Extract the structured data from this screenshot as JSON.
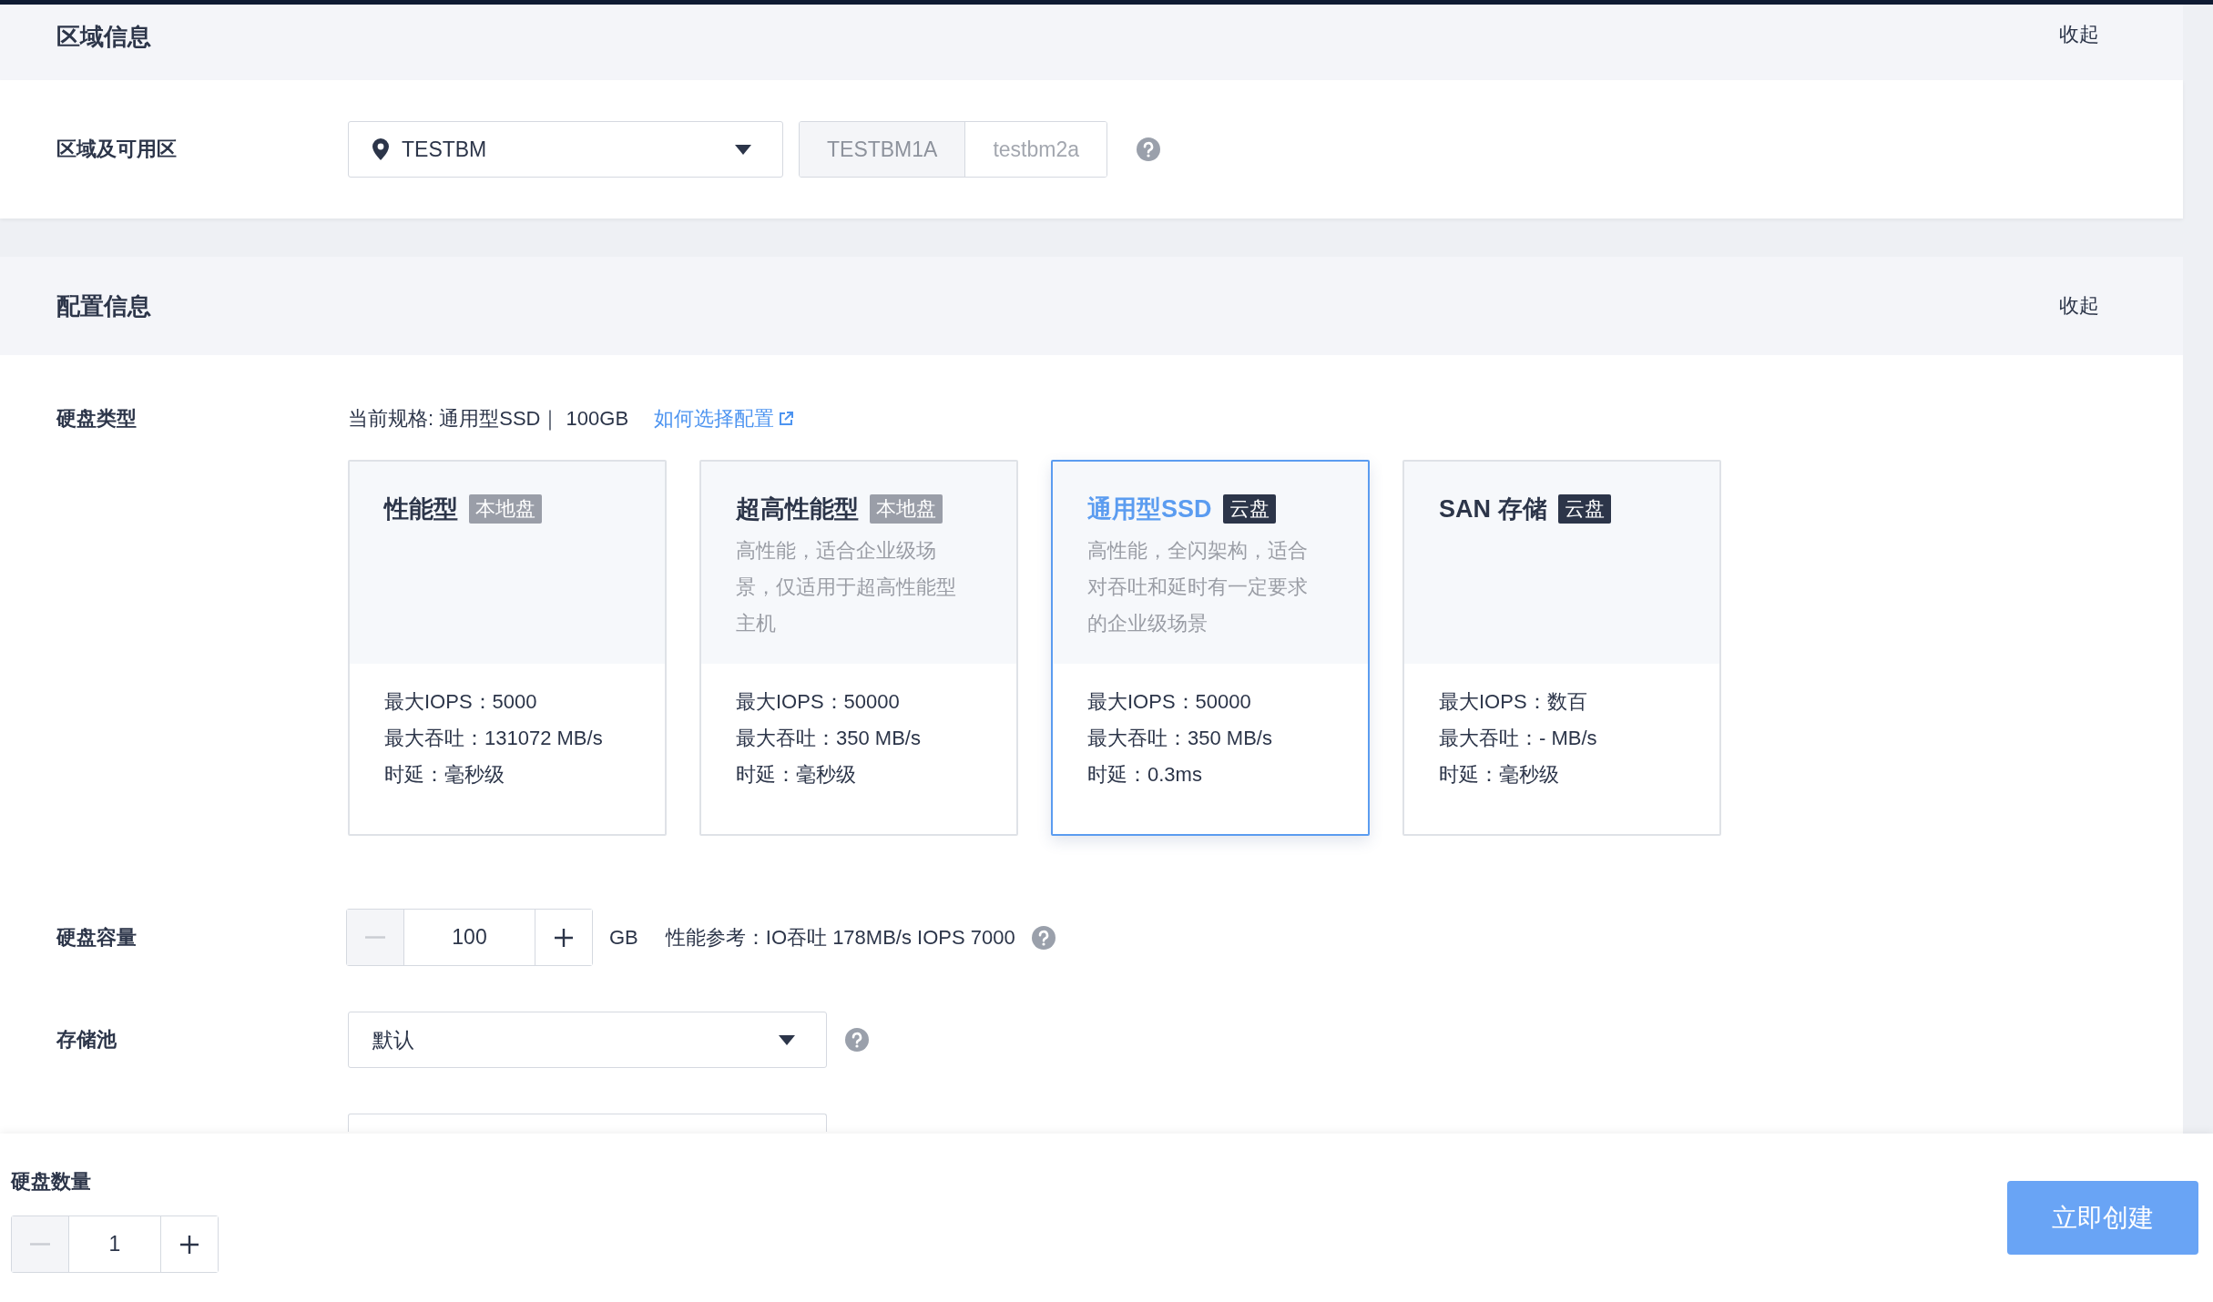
{
  "region_section": {
    "title": "区域信息",
    "toggle": "收起"
  },
  "region": {
    "label": "区域及可用区",
    "select": {
      "value": "TESTBM"
    },
    "zones": [
      {
        "label": "TESTBM1A",
        "selected": true
      },
      {
        "label": "testbm2a",
        "selected": false
      }
    ]
  },
  "config_section": {
    "title": "配置信息",
    "toggle": "收起"
  },
  "disk_type": {
    "label": "硬盘类型",
    "current_spec": "当前规格: 通用型SSD｜ 100GB",
    "help_link": "如何选择配置",
    "cards": [
      {
        "name": "性能型",
        "tag": {
          "text": "本地盘",
          "color": "#9a9ea8"
        },
        "selected": false,
        "specs": [
          "最大IOPS：5000",
          "最大吞吐：131072 MB/s",
          "时延：毫秒级"
        ]
      },
      {
        "name": "超高性能型",
        "tag": {
          "text": "本地盘",
          "color": "#9a9ea8"
        },
        "description": "高性能，适合企业级场景，仅适用于超高性能型主机",
        "selected": false,
        "specs": [
          "最大IOPS：50000",
          "最大吞吐：350 MB/s",
          "时延：毫秒级"
        ]
      },
      {
        "name": "通用型SSD",
        "tag": {
          "text": "云盘",
          "color": "#2c3549"
        },
        "description": "高性能，全闪架构，适合对吞吐和延时有一定要求的企业级场景",
        "selected": true,
        "specs": [
          "最大IOPS：50000",
          "最大吞吐：350 MB/s",
          "时延：0.3ms"
        ]
      },
      {
        "name": "SAN 存储",
        "tag": {
          "text": "云盘",
          "color": "#2c3549"
        },
        "selected": false,
        "specs": [
          "最大IOPS：数百",
          "最大吞吐：- MB/s",
          "时延：毫秒级"
        ]
      }
    ]
  },
  "capacity": {
    "label": "硬盘容量",
    "stepper": {
      "value": "100",
      "minus_disabled": true,
      "plus_disabled": false
    },
    "unit": "GB",
    "performance": "性能参考：IO吞吐 178MB/s IOPS 7000"
  },
  "storage_pool": {
    "label": "存储池",
    "select": {
      "value": "默认"
    }
  },
  "footer": {
    "label": "硬盘数量",
    "stepper": {
      "value": "1",
      "minus_disabled": true,
      "plus_disabled": false
    },
    "submit": "立即创建"
  }
}
